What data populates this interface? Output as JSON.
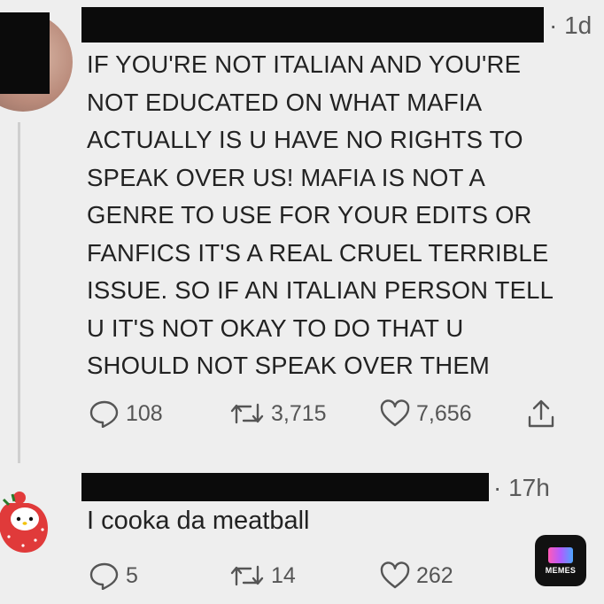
{
  "tweet1": {
    "time": "· 1d",
    "text": "IF YOU'RE NOT ITALIAN AND YOU'RE\nNOT EDUCATED ON WHAT MAFIA\nACTUALLY IS U HAVE NO RIGHTS TO\nSPEAK OVER US! MAFIA IS NOT A\nGENRE TO USE FOR YOUR EDITS OR\nFANFICS IT'S A REAL CRUEL TERRIBLE\nISSUE. SO IF AN ITALIAN PERSON TELL\nU IT'S NOT OKAY TO DO THAT U\nSHOULD NOT SPEAK OVER THEM",
    "replies": "108",
    "retweets": "3,715",
    "likes": "7,656"
  },
  "tweet2": {
    "time": "· 17h",
    "text": "I cooka da meatball",
    "replies": "5",
    "retweets": "14",
    "likes": "262"
  },
  "watermark": {
    "label": "MEMES"
  },
  "icons": {
    "reply": "speech-bubble-icon",
    "retweet": "retweet-arrows-icon",
    "like": "heart-icon",
    "share": "share-upload-icon"
  }
}
